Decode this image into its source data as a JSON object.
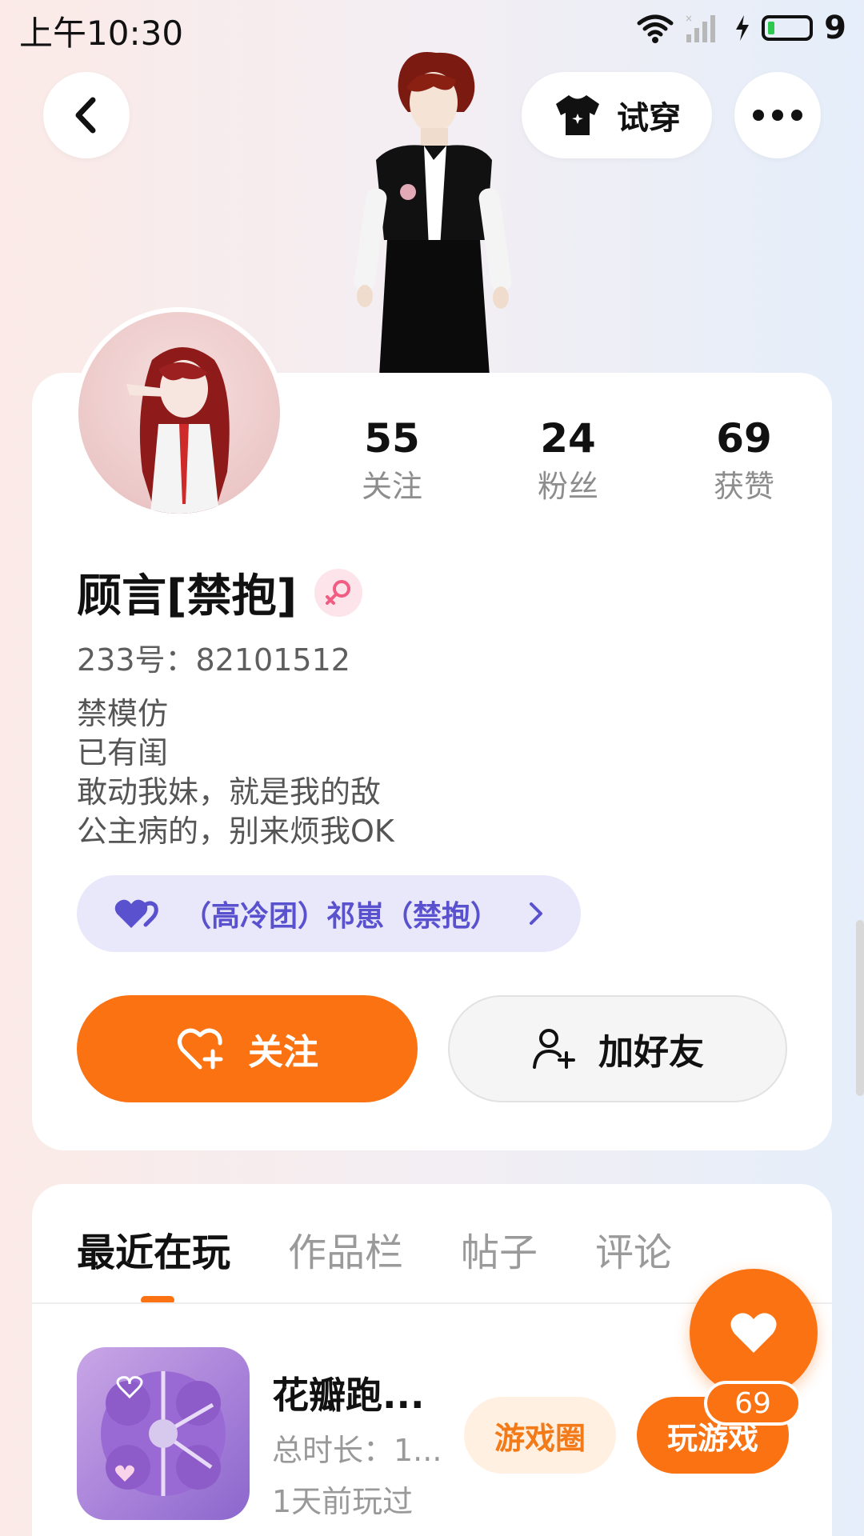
{
  "status_bar": {
    "time": "上午10:30",
    "battery": "9"
  },
  "header": {
    "tryon_label": "试穿"
  },
  "stats": [
    {
      "value": "55",
      "label": "关注"
    },
    {
      "value": "24",
      "label": "粉丝"
    },
    {
      "value": "69",
      "label": "获赞"
    }
  ],
  "profile": {
    "name": "顾言[禁抱]",
    "uid": "233号：82101512",
    "bio": [
      "禁模仿",
      "已有闺",
      "敢动我妹，就是我的敌",
      "公主病的，别来烦我OK"
    ],
    "couple": "（高冷团）祁崽（禁抱）"
  },
  "actions": {
    "follow_label": "关注",
    "add_friend_label": "加好友"
  },
  "tabs": [
    "最近在玩",
    "作品栏",
    "帖子",
    "评论"
  ],
  "game": {
    "title": "花瓣跑...",
    "duration": "总时长：1...",
    "last_played": "1天前玩过",
    "circle_label": "游戏圈",
    "play_label": "玩游戏"
  },
  "like_fab": {
    "count": "69"
  },
  "colors": {
    "accent": "#fb7213",
    "couple": "#5a51cf"
  }
}
